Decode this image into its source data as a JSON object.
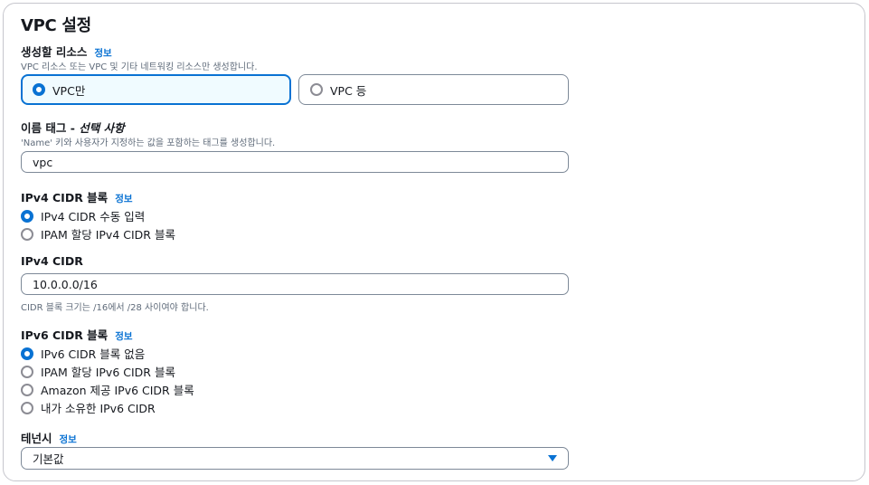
{
  "panel_title": "VPC 설정",
  "resources": {
    "label": "생성할 리소스",
    "info": "정보",
    "desc": "VPC 리소스 또는 VPC 및 기타 네트워킹 리소스만 생성합니다.",
    "options": [
      "VPC만",
      "VPC 등"
    ],
    "selected": "VPC만"
  },
  "name_tag": {
    "label": "이름 태그 - ",
    "label_optional": "선택 사항",
    "desc": "'Name' 키와 사용자가 지정하는 값을 포함하는 태그를 생성합니다.",
    "value": "vpc"
  },
  "ipv4_block": {
    "label": "IPv4 CIDR 블록",
    "info": "정보",
    "options": [
      "IPv4 CIDR 수동 입력",
      "IPAM 할당 IPv4 CIDR 블록"
    ],
    "selected": "IPv4 CIDR 수동 입력"
  },
  "ipv4_cidr": {
    "label": "IPv4 CIDR",
    "value": "10.0.0.0/16",
    "hint": "CIDR 블록 크기는 /16에서 /28 사이여야 합니다."
  },
  "ipv6_block": {
    "label": "IPv6 CIDR 블록",
    "info": "정보",
    "options": [
      "IPv6 CIDR 블록 없음",
      "IPAM 할당 IPv6 CIDR 블록",
      "Amazon 제공 IPv6 CIDR 블록",
      "내가 소유한 IPv6 CIDR"
    ],
    "selected": "IPv6 CIDR 블록 없음"
  },
  "tenancy": {
    "label": "테넌시",
    "info": "정보",
    "value": "기본값"
  },
  "colors": {
    "accent": "#0972d3",
    "border": "#7d8998",
    "selected_bg": "#f0fbff"
  }
}
